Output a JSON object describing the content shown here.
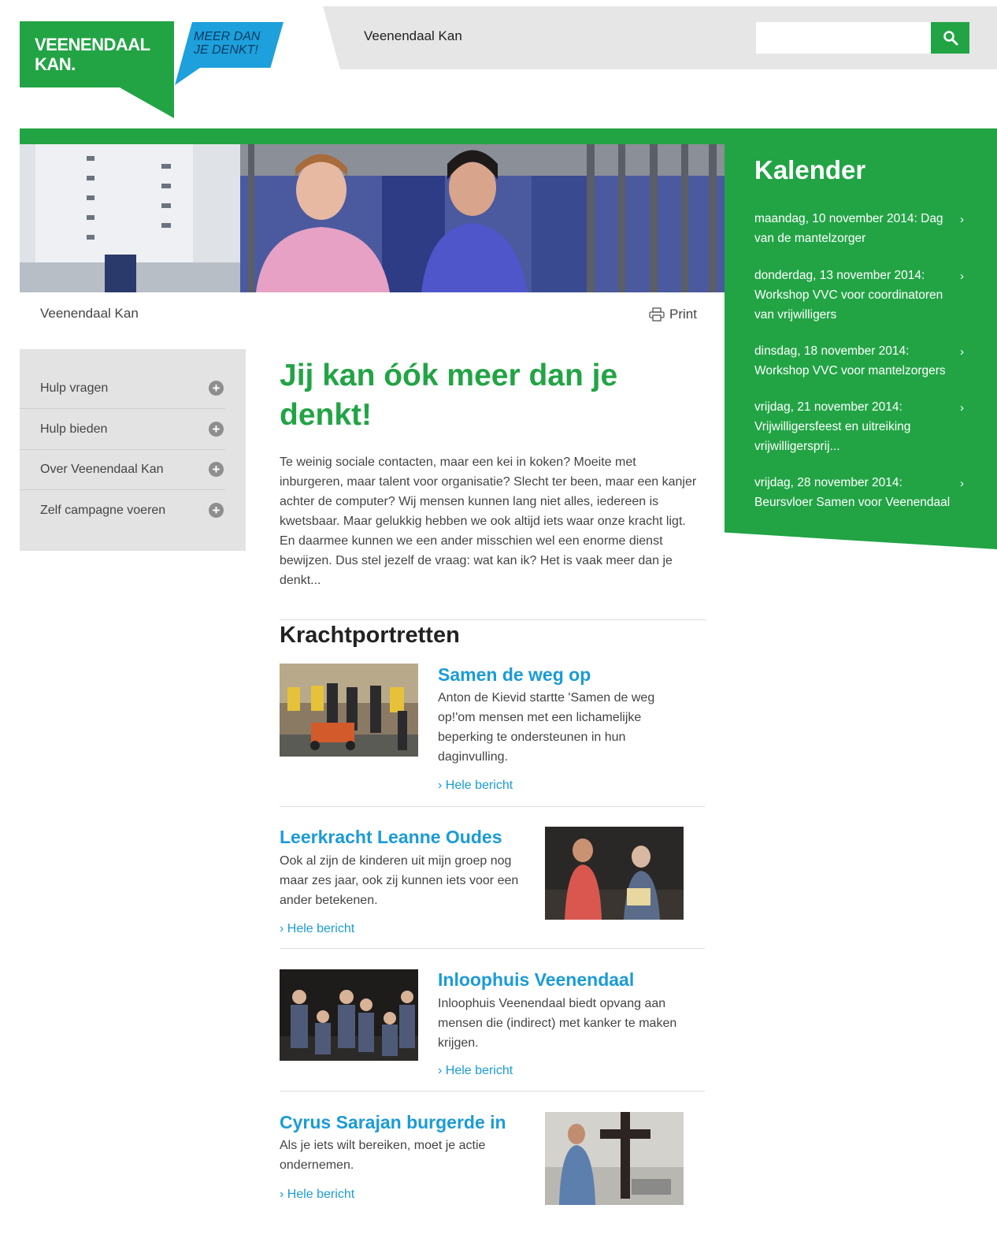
{
  "header": {
    "logo_line1": "VEENENDAAL",
    "logo_line2": "KAN.",
    "tagline_line1": "MEER DAN",
    "tagline_line2": "JE DENKT!",
    "site_name": "Veenendaal Kan",
    "search_placeholder": ""
  },
  "breadcrumb": "Veenendaal Kan",
  "print_label": "Print",
  "sidenav": [
    {
      "label": "Hulp vragen"
    },
    {
      "label": "Hulp bieden"
    },
    {
      "label": "Over Veenendaal Kan"
    },
    {
      "label": "Zelf campagne voeren"
    }
  ],
  "main": {
    "title": "Jij kan óók meer dan je denkt!",
    "intro": "Te weinig sociale contacten, maar een kei in koken? Moeite met inburgeren, maar talent voor organisatie? Slecht ter been, maar een kanjer achter de computer? Wij mensen kunnen lang niet alles, iedereen is kwetsbaar. Maar gelukkig hebben we ook altijd iets waar onze kracht ligt. En daarmee kunnen we een ander misschien wel een enorme dienst bewijzen. Dus stel jezelf de vraag: wat kan ik? Het is vaak meer dan je denkt...",
    "section_title": "Krachtportretten",
    "portraits": [
      {
        "title": "Samen de weg op",
        "text": "Anton de Kievid startte 'Samen de weg op!'om mensen met een lichamelijke beperking te ondersteunen in hun daginvulling.",
        "link": "Hele bericht"
      },
      {
        "title": "Leerkracht Leanne Oudes",
        "text": "Ook al zijn de kinderen uit mijn groep nog maar zes jaar, ook zij kunnen iets voor een ander betekenen.",
        "link": "Hele bericht"
      },
      {
        "title": "Inloophuis Veenendaal",
        "text": "Inloophuis Veenendaal biedt opvang aan mensen die (indirect) met kanker te maken krijgen.",
        "link": "Hele bericht"
      },
      {
        "title": "Cyrus Sarajan burgerde in",
        "text": "Als je iets wilt bereiken, moet je actie ondernemen.",
        "link": "Hele bericht"
      }
    ]
  },
  "kalender": {
    "title": "Kalender",
    "items": [
      {
        "line1": "maandag, 10 november 2014: Dag",
        "line2": "van de mantelzorger",
        "line3": ""
      },
      {
        "line1": "donderdag, 13 november 2014:",
        "line2": "Workshop VVC voor coordinatoren",
        "line3": "van vrijwilligers"
      },
      {
        "line1": "dinsdag, 18 november 2014:",
        "line2": "Workshop VVC voor mantelzorgers",
        "line3": ""
      },
      {
        "line1": "vrijdag, 21 november 2014:",
        "line2": "Vrijwilligersfeest en uitreiking",
        "line3": "vrijwilligersprij..."
      },
      {
        "line1": "vrijdag, 28 november 2014:",
        "line2": "Beursvloer Samen voor Veenendaal",
        "line3": ""
      }
    ],
    "arrow": "›"
  },
  "colors": {
    "brand_green": "#22a445",
    "accent_blue": "#1b9bd7",
    "tagline_blue": "#1da0db"
  },
  "icons": {
    "search": "search-icon",
    "print": "printer-icon",
    "plus": "plus-circle-icon",
    "link_arrow": "›"
  }
}
